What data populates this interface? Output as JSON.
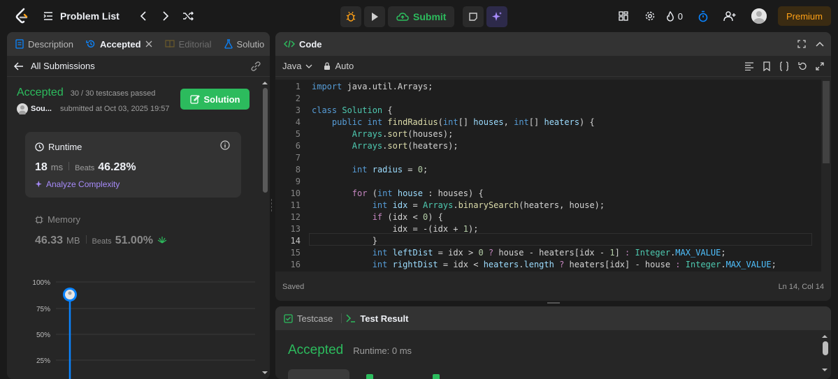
{
  "topbar": {
    "problem_list": "Problem List",
    "submit": "Submit",
    "streak": "0",
    "premium": "Premium"
  },
  "left": {
    "tabs": [
      "Description",
      "Accepted",
      "Editorial",
      "Solutio"
    ],
    "all_submissions": "All Submissions",
    "status": "Accepted",
    "testcases": "30 / 30 testcases passed",
    "user": "Sou...",
    "submitted": "submitted at Oct 03, 2025 19:57",
    "solution_btn": "Solution",
    "runtime": {
      "label": "Runtime",
      "value": "18",
      "unit": "ms",
      "beats_label": "Beats",
      "beats": "46.28%",
      "analyze": "Analyze Complexity"
    },
    "memory": {
      "label": "Memory",
      "value": "46.33",
      "unit": "MB",
      "beats_label": "Beats",
      "beats": "51.00%"
    },
    "chart_ticks": [
      "100%",
      "75%",
      "50%",
      "25%"
    ]
  },
  "code": {
    "title": "Code",
    "language": "Java",
    "mode": "Auto",
    "lines": [
      "1",
      "2",
      "3",
      "4",
      "5",
      "6",
      "7",
      "8",
      "9",
      "10",
      "11",
      "12",
      "13",
      "14",
      "15",
      "16"
    ],
    "status_left": "Saved",
    "status_right": "Ln 14, Col 14"
  },
  "test": {
    "tabs": [
      "Testcase",
      "Test Result"
    ],
    "result": "Accepted",
    "runtime": "Runtime: 0 ms"
  },
  "colors": {
    "accent_green": "#2cbb5d",
    "premium_orange": "#ffa116",
    "chart_blue": "#0a84ff"
  }
}
